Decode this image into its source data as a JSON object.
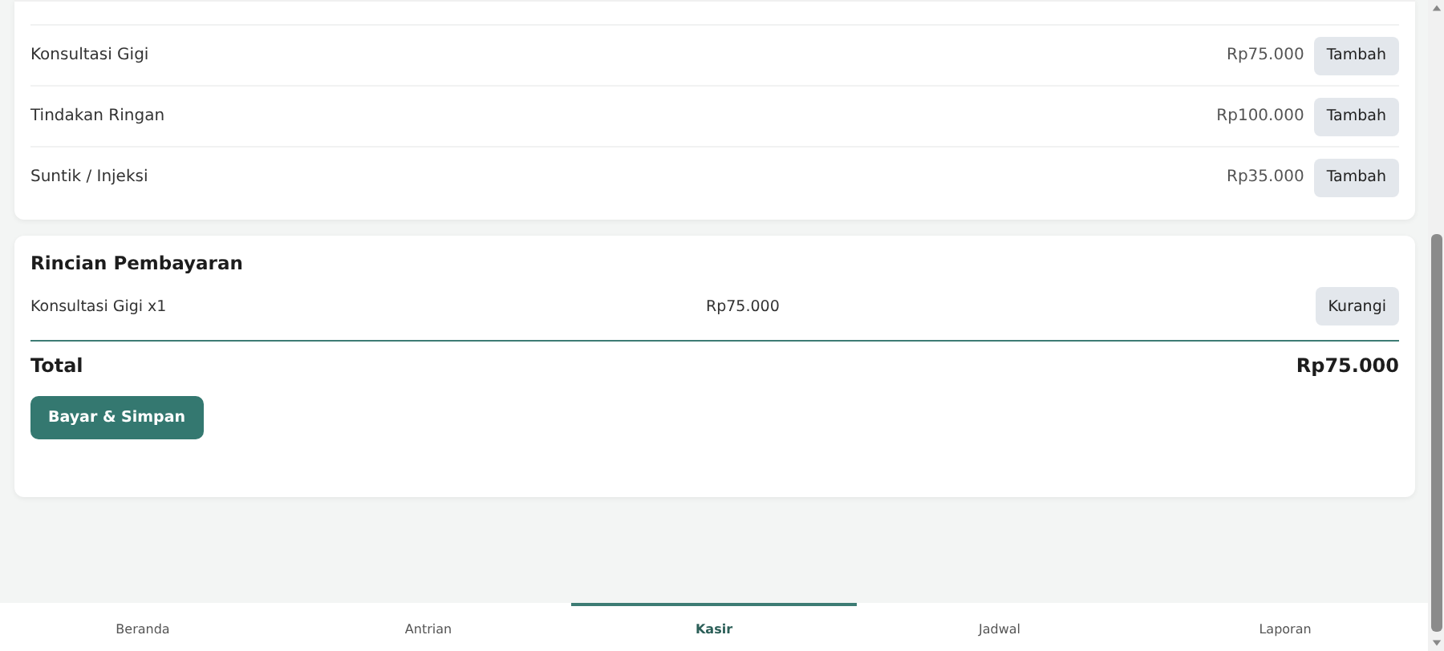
{
  "services": [
    {
      "name": "Konsultasi Gigi",
      "price": "Rp75.000",
      "button": "Tambah"
    },
    {
      "name": "Tindakan Ringan",
      "price": "Rp100.000",
      "button": "Tambah"
    },
    {
      "name": "Suntik / Injeksi",
      "price": "Rp35.000",
      "button": "Tambah"
    }
  ],
  "payment": {
    "title": "Rincian Pembayaran",
    "items": [
      {
        "name": "Konsultasi Gigi x1",
        "price": "Rp75.000",
        "button": "Kurangi"
      }
    ],
    "total_label": "Total",
    "total_value": "Rp75.000",
    "pay_button": "Bayar & Simpan"
  },
  "nav": [
    {
      "label": "Beranda",
      "selected": false
    },
    {
      "label": "Antrian",
      "selected": false
    },
    {
      "label": "Kasir",
      "selected": true
    },
    {
      "label": "Jadwal",
      "selected": false
    },
    {
      "label": "Laporan",
      "selected": false
    }
  ]
}
